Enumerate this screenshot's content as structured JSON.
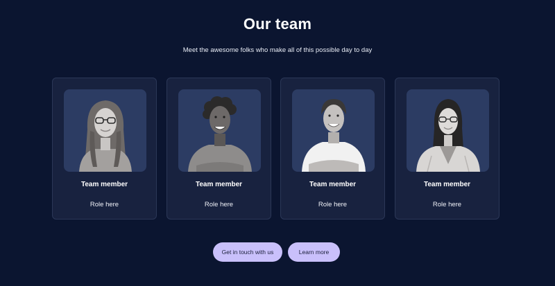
{
  "header": {
    "title": "Our team",
    "subtitle": "Meet the awesome folks who make all of this possible day to day"
  },
  "members": [
    {
      "name": "Team member",
      "role": "Role here"
    },
    {
      "name": "Team member",
      "role": "Role here"
    },
    {
      "name": "Team member",
      "role": "Role here"
    },
    {
      "name": "Team member",
      "role": "Role here"
    }
  ],
  "actions": {
    "contact_label": "Get in touch with us",
    "learn_label": "Learn more"
  },
  "colors": {
    "background": "#0b1530",
    "card": "#18223f",
    "photo_bg": "#2c3c63",
    "button": "#c9c0fb"
  }
}
